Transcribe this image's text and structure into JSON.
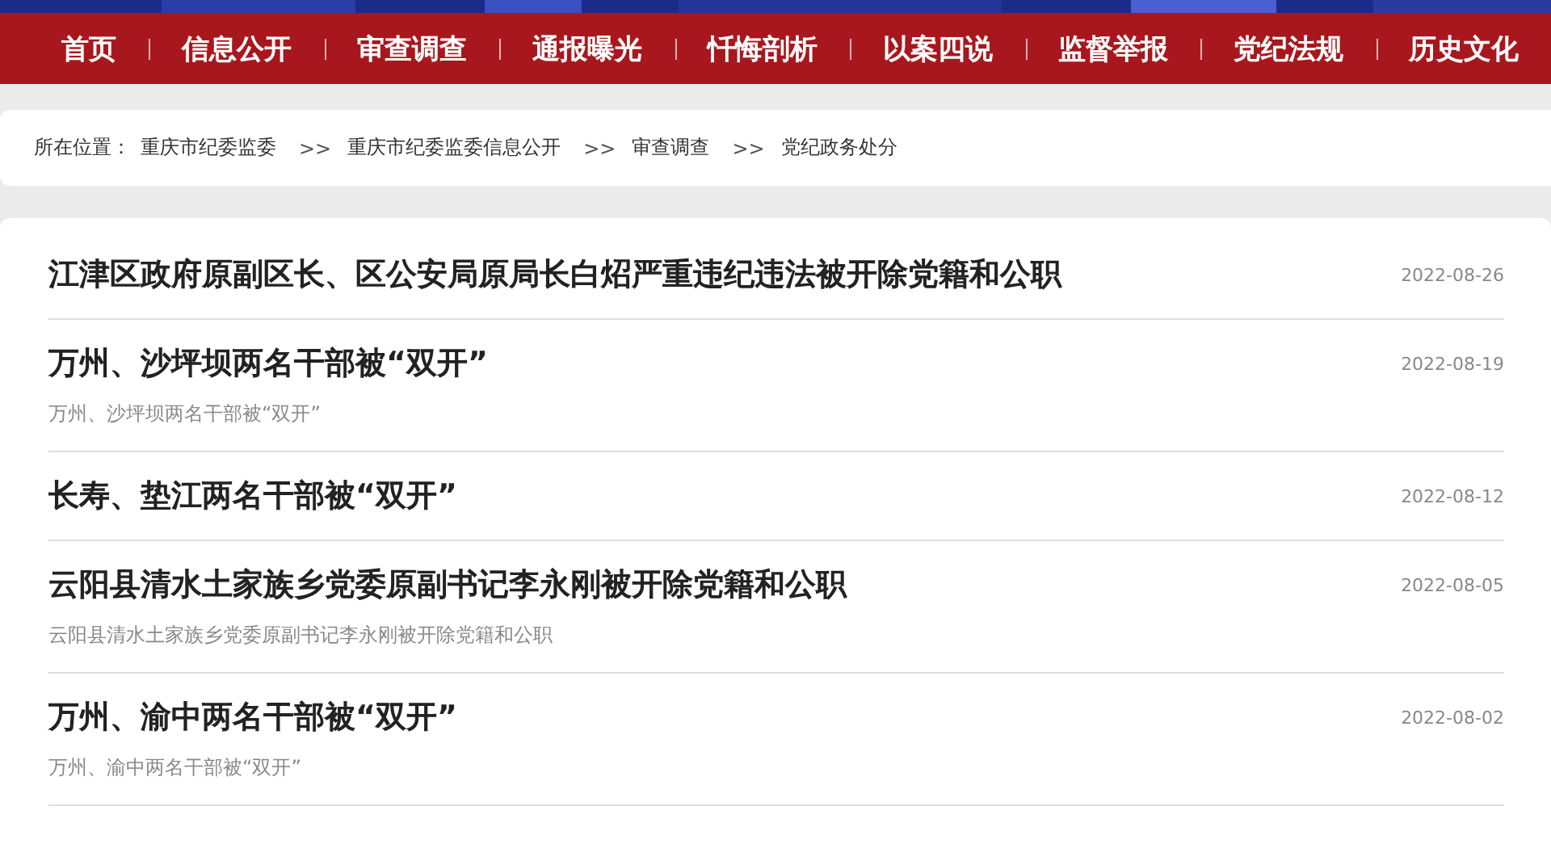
{
  "nav": [
    {
      "label": "首页"
    },
    {
      "label": "信息公开"
    },
    {
      "label": "审查调查"
    },
    {
      "label": "通报曝光"
    },
    {
      "label": "忏悔剖析"
    },
    {
      "label": "以案四说"
    },
    {
      "label": "监督举报"
    },
    {
      "label": "党纪法规"
    },
    {
      "label": "历史文化"
    }
  ],
  "breadcrumb": {
    "prefix": "所在位置：",
    "items": [
      "重庆市纪委监委",
      "重庆市纪委监委信息公开",
      "审查调查",
      "党纪政务处分"
    ],
    "separator": ">>"
  },
  "articles": [
    {
      "title": "江津区政府原副区长、区公安局原局长白炤严重违纪违法被开除党籍和公职",
      "date": "2022-08-26"
    },
    {
      "title": "万州、沙坪坝两名干部被“双开”",
      "date": "2022-08-19",
      "summary": "万州、沙坪坝两名干部被“双开”"
    },
    {
      "title": "长寿、垫江两名干部被“双开”",
      "date": "2022-08-12"
    },
    {
      "title": "云阳县清水土家族乡党委原副书记李永刚被开除党籍和公职",
      "date": "2022-08-05",
      "summary": "云阳县清水土家族乡党委原副书记李永刚被开除党籍和公职"
    },
    {
      "title": "万州、渝中两名干部被“双开”",
      "date": "2022-08-02",
      "summary": "万州、渝中两名干部被“双开”"
    }
  ]
}
